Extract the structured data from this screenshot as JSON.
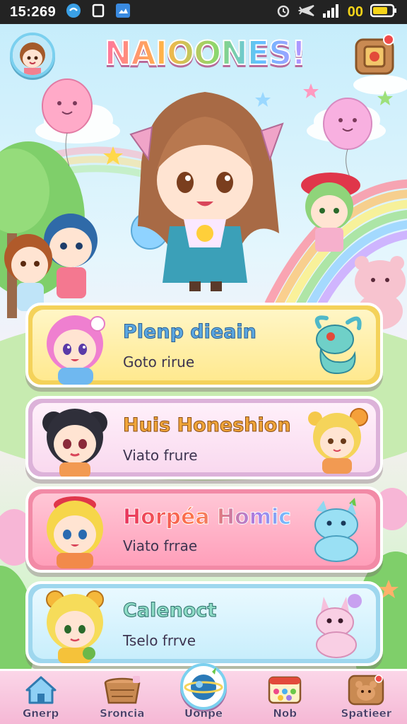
{
  "status_bar": {
    "time": "15:269",
    "battery_text": "00",
    "icons": [
      "vpn-icon",
      "square-icon",
      "image-icon",
      "alarm-icon",
      "airplane-icon",
      "signal-icon",
      "battery-icon"
    ]
  },
  "header": {
    "title": "NAIOONES!",
    "avatar_icon": "player-avatar",
    "gift_icon": "gift-box-icon"
  },
  "modes": [
    {
      "title": "Plenp dieain",
      "subtitle": "Goto rirue",
      "character": "pink-hair-girl",
      "pet": "teal-dino"
    },
    {
      "title": "Huis Honeshion",
      "subtitle": "Viato frure",
      "character": "black-hair-girl",
      "pet": "blonde-bear-girl"
    },
    {
      "title": "Horpéa Homic",
      "subtitle": "Viato frrae",
      "character": "blonde-red-hat-girl",
      "pet": "blue-cat"
    },
    {
      "title": "Calenoct",
      "subtitle": "Tselo frrve",
      "character": "yellow-bear-hood-girl",
      "pet": "pink-bunny"
    }
  ],
  "nav": {
    "items": [
      {
        "label": "Gnerp",
        "icon": "home-icon"
      },
      {
        "label": "Sroncia",
        "icon": "basket-icon"
      },
      {
        "label": "Uonpe",
        "icon": "planet-icon"
      },
      {
        "label": "Nob",
        "icon": "palette-icon"
      },
      {
        "label": "Spatieer",
        "icon": "pet-bear-icon"
      }
    ],
    "active_index": 2
  },
  "colors": {
    "card_yellow": "#f4d25a",
    "card_lilac": "#dcb2d9",
    "card_pink": "#f28aa6",
    "card_blue": "#9ed7ee",
    "nav_bg": "#f5b8d5"
  }
}
